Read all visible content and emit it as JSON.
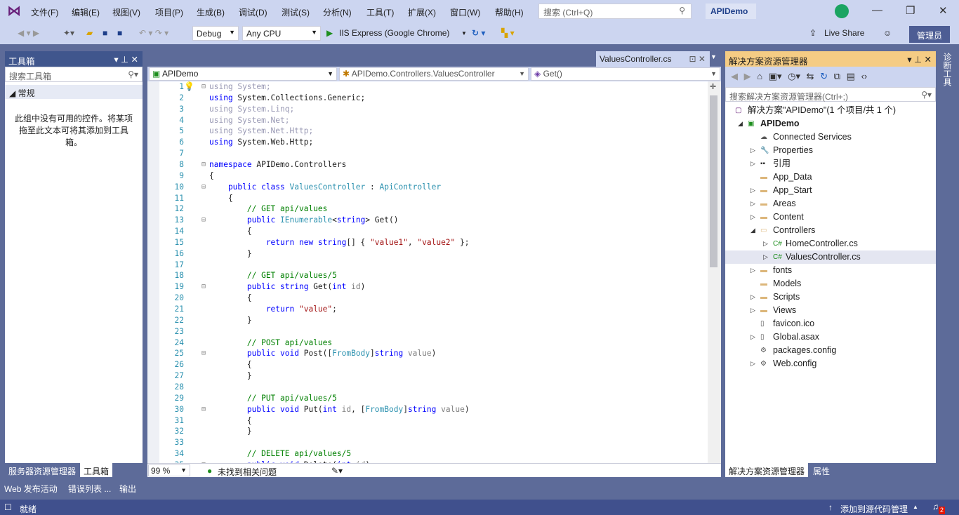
{
  "menubar": {
    "items": [
      "文件(F)",
      "编辑(E)",
      "视图(V)",
      "项目(P)",
      "生成(B)",
      "调试(D)",
      "测试(S)",
      "分析(N)",
      "工具(T)",
      "扩展(X)",
      "窗口(W)",
      "帮助(H)"
    ],
    "search_placeholder": "搜索 (Ctrl+Q)",
    "title": "APIDemo"
  },
  "toolbar": {
    "config": "Debug",
    "platform": "Any CPU",
    "run": "IIS Express (Google Chrome)",
    "live_share": "Live Share",
    "admin": "管理员"
  },
  "toolbox": {
    "title": "工具箱",
    "search_placeholder": "搜索工具箱",
    "group": "常规",
    "empty_text": "此组中没有可用的控件。将某项拖至此文本可将其添加到工具箱。",
    "tabs": [
      "服务器资源管理器",
      "工具箱"
    ]
  },
  "editor": {
    "tab": "ValuesController.cs",
    "nav_project": "APIDemo",
    "nav_class": "APIDemo.Controllers.ValuesController",
    "nav_member": "Get()",
    "zoom": "99 %",
    "issues": "未找到相关问题",
    "lines": [
      [
        [
          "using System;",
          "dim"
        ]
      ],
      [
        [
          "using",
          "kw"
        ],
        [
          " System.Collections.Generic;",
          ""
        ]
      ],
      [
        [
          "using System.Linq;",
          "dim"
        ]
      ],
      [
        [
          "using System.Net;",
          "dim"
        ]
      ],
      [
        [
          "using System.Net.Http;",
          "dim"
        ]
      ],
      [
        [
          "using",
          "kw"
        ],
        [
          " System.Web.Http;",
          ""
        ]
      ],
      [],
      [
        [
          "namespace",
          "kw"
        ],
        [
          " APIDemo.Controllers",
          ""
        ]
      ],
      [
        [
          "{",
          ""
        ]
      ],
      [
        [
          "    public class ",
          "kw"
        ],
        [
          "ValuesController",
          "ty"
        ],
        [
          " : ",
          ""
        ],
        [
          "ApiController",
          "ty"
        ]
      ],
      [
        [
          "    {",
          ""
        ]
      ],
      [
        [
          "        // GET api/values",
          "cm"
        ]
      ],
      [
        [
          "        public ",
          "kw"
        ],
        [
          "IEnumerable",
          "ty"
        ],
        [
          "<",
          ""
        ],
        [
          "string",
          "kw"
        ],
        [
          "> Get()",
          ""
        ]
      ],
      [
        [
          "        {",
          ""
        ]
      ],
      [
        [
          "            return new string",
          "kw"
        ],
        [
          "[] { ",
          ""
        ],
        [
          "\"value1\"",
          "st"
        ],
        [
          ", ",
          ""
        ],
        [
          "\"value2\"",
          "st"
        ],
        [
          " };",
          ""
        ]
      ],
      [
        [
          "        }",
          ""
        ]
      ],
      [],
      [
        [
          "        // GET api/values/5",
          "cm"
        ]
      ],
      [
        [
          "        public string ",
          "kw"
        ],
        [
          "Get(",
          ""
        ],
        [
          "int ",
          "kw"
        ],
        [
          "id",
          "prm"
        ],
        [
          ")",
          ""
        ]
      ],
      [
        [
          "        {",
          ""
        ]
      ],
      [
        [
          "            return ",
          "kw"
        ],
        [
          "\"value\"",
          "st"
        ],
        [
          ";",
          ""
        ]
      ],
      [
        [
          "        }",
          ""
        ]
      ],
      [],
      [
        [
          "        // POST api/values",
          "cm"
        ]
      ],
      [
        [
          "        public void ",
          "kw"
        ],
        [
          "Post([",
          ""
        ],
        [
          "FromBody",
          "ty"
        ],
        [
          "]",
          ""
        ],
        [
          "string ",
          "kw"
        ],
        [
          "value",
          "prm"
        ],
        [
          ")",
          ""
        ]
      ],
      [
        [
          "        {",
          ""
        ]
      ],
      [
        [
          "        }",
          ""
        ]
      ],
      [],
      [
        [
          "        // PUT api/values/5",
          "cm"
        ]
      ],
      [
        [
          "        public void ",
          "kw"
        ],
        [
          "Put(",
          ""
        ],
        [
          "int ",
          "kw"
        ],
        [
          "id",
          "prm"
        ],
        [
          ", [",
          ""
        ],
        [
          "FromBody",
          "ty"
        ],
        [
          "]",
          ""
        ],
        [
          "string ",
          "kw"
        ],
        [
          "value",
          "prm"
        ],
        [
          ")",
          ""
        ]
      ],
      [
        [
          "        {",
          ""
        ]
      ],
      [
        [
          "        }",
          ""
        ]
      ],
      [],
      [
        [
          "        // DELETE api/values/5",
          "cm"
        ]
      ],
      [
        [
          "        public void ",
          "kw"
        ],
        [
          "Delete(",
          ""
        ],
        [
          "int ",
          "kw"
        ],
        [
          "id",
          "prm"
        ],
        [
          ")",
          ""
        ]
      ]
    ]
  },
  "solution": {
    "title": "解决方案资源管理器",
    "search_placeholder": "搜索解决方案资源管理器(Ctrl+;)",
    "items": [
      {
        "label": "解决方案\"APIDemo\"(1 个项目/共 1 个)",
        "depth": 0,
        "twisty": "",
        "icon": "solution-icon"
      },
      {
        "label": "APIDemo",
        "depth": 1,
        "twisty": "open",
        "icon": "web-project-icon",
        "bold": true
      },
      {
        "label": "Connected Services",
        "depth": 2,
        "twisty": "",
        "icon": "cloud-icon"
      },
      {
        "label": "Properties",
        "depth": 2,
        "twisty": "closed",
        "icon": "wrench-icon"
      },
      {
        "label": "引用",
        "depth": 2,
        "twisty": "closed",
        "icon": "references-icon"
      },
      {
        "label": "App_Data",
        "depth": 2,
        "twisty": "",
        "icon": "folder-icon"
      },
      {
        "label": "App_Start",
        "depth": 2,
        "twisty": "closed",
        "icon": "folder-icon"
      },
      {
        "label": "Areas",
        "depth": 2,
        "twisty": "closed",
        "icon": "folder-icon"
      },
      {
        "label": "Content",
        "depth": 2,
        "twisty": "closed",
        "icon": "folder-icon"
      },
      {
        "label": "Controllers",
        "depth": 2,
        "twisty": "open",
        "icon": "folder-open-icon"
      },
      {
        "label": "HomeController.cs",
        "depth": 3,
        "twisty": "closed",
        "icon": "csharp-icon"
      },
      {
        "label": "ValuesController.cs",
        "depth": 3,
        "twisty": "closed",
        "icon": "csharp-icon",
        "selected": true
      },
      {
        "label": "fonts",
        "depth": 2,
        "twisty": "closed",
        "icon": "folder-icon"
      },
      {
        "label": "Models",
        "depth": 2,
        "twisty": "",
        "icon": "folder-icon"
      },
      {
        "label": "Scripts",
        "depth": 2,
        "twisty": "closed",
        "icon": "folder-icon"
      },
      {
        "label": "Views",
        "depth": 2,
        "twisty": "closed",
        "icon": "folder-icon"
      },
      {
        "label": "favicon.ico",
        "depth": 2,
        "twisty": "",
        "icon": "file-icon"
      },
      {
        "label": "Global.asax",
        "depth": 2,
        "twisty": "closed",
        "icon": "file-icon"
      },
      {
        "label": "packages.config",
        "depth": 2,
        "twisty": "",
        "icon": "config-icon"
      },
      {
        "label": "Web.config",
        "depth": 2,
        "twisty": "closed",
        "icon": "config-icon"
      }
    ],
    "tabs": [
      "解决方案资源管理器",
      "属性"
    ]
  },
  "side_tab": "诊断工具",
  "bottom_tabs": [
    "Web 发布活动",
    "错误列表 ...",
    "输出"
  ],
  "statusbar": {
    "status": "就绪",
    "source_control": "添加到源代码管理",
    "notifications": "2"
  },
  "colors": {
    "chrome": "#CCD5F0",
    "dock": "#5D6B99",
    "active_header": "#F5CC84",
    "status": "#40508D",
    "accent": "#68217A"
  }
}
